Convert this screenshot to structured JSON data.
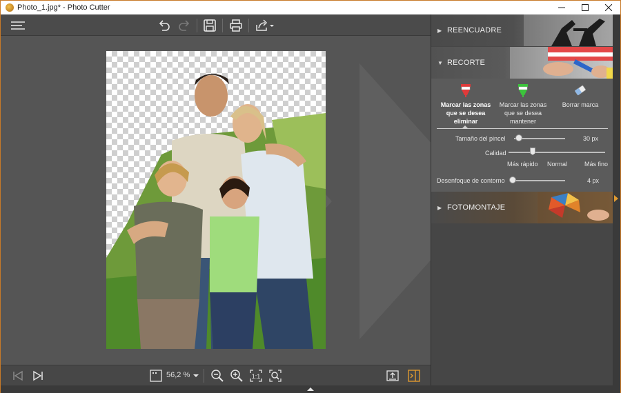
{
  "window": {
    "title": "Photo_1.jpg* - Photo Cutter",
    "controls": [
      "minimize",
      "maximize",
      "close"
    ]
  },
  "toolbar": {
    "icons": [
      "menu-icon",
      "undo-icon",
      "redo-icon",
      "save-icon",
      "print-icon",
      "share-icon"
    ]
  },
  "canvas": {
    "image_description": "family-photo"
  },
  "bottombar": {
    "zoom_value": "56,2 %",
    "icons": [
      "first-image-icon",
      "last-image-icon",
      "fit-icon",
      "zoom-out-icon",
      "zoom-in-icon",
      "actual-size-icon",
      "zoom-fit-icon",
      "export-icon",
      "split-view-icon"
    ]
  },
  "panel": {
    "sections": [
      {
        "label": "REENCUADRE",
        "expanded": false
      },
      {
        "label": "RECORTE",
        "expanded": true
      },
      {
        "label": "FOTOMONTAJE",
        "expanded": false
      }
    ],
    "tools": {
      "remove_label": "Marcar las zonas que se desea eliminar",
      "keep_label": "Marcar las zonas que se desea mantener",
      "erase_label": "Borrar marca",
      "remove_color": "#e03a3a",
      "keep_color": "#3cc43c"
    },
    "brush_size_label": "Tamaño del pincel",
    "brush_size_value": "30 px",
    "brush_size_fraction": 0.1,
    "quality_label": "Calidad",
    "quality_options": [
      "Más rápido",
      "Normal",
      "Más fino"
    ],
    "quality_fraction": 0.25,
    "blur_label": "Desenfoque de contorno",
    "blur_value": "4 px",
    "blur_fraction": 0.0
  },
  "colors": {
    "accent": "#e09a30",
    "window_border": "#c87a28"
  }
}
